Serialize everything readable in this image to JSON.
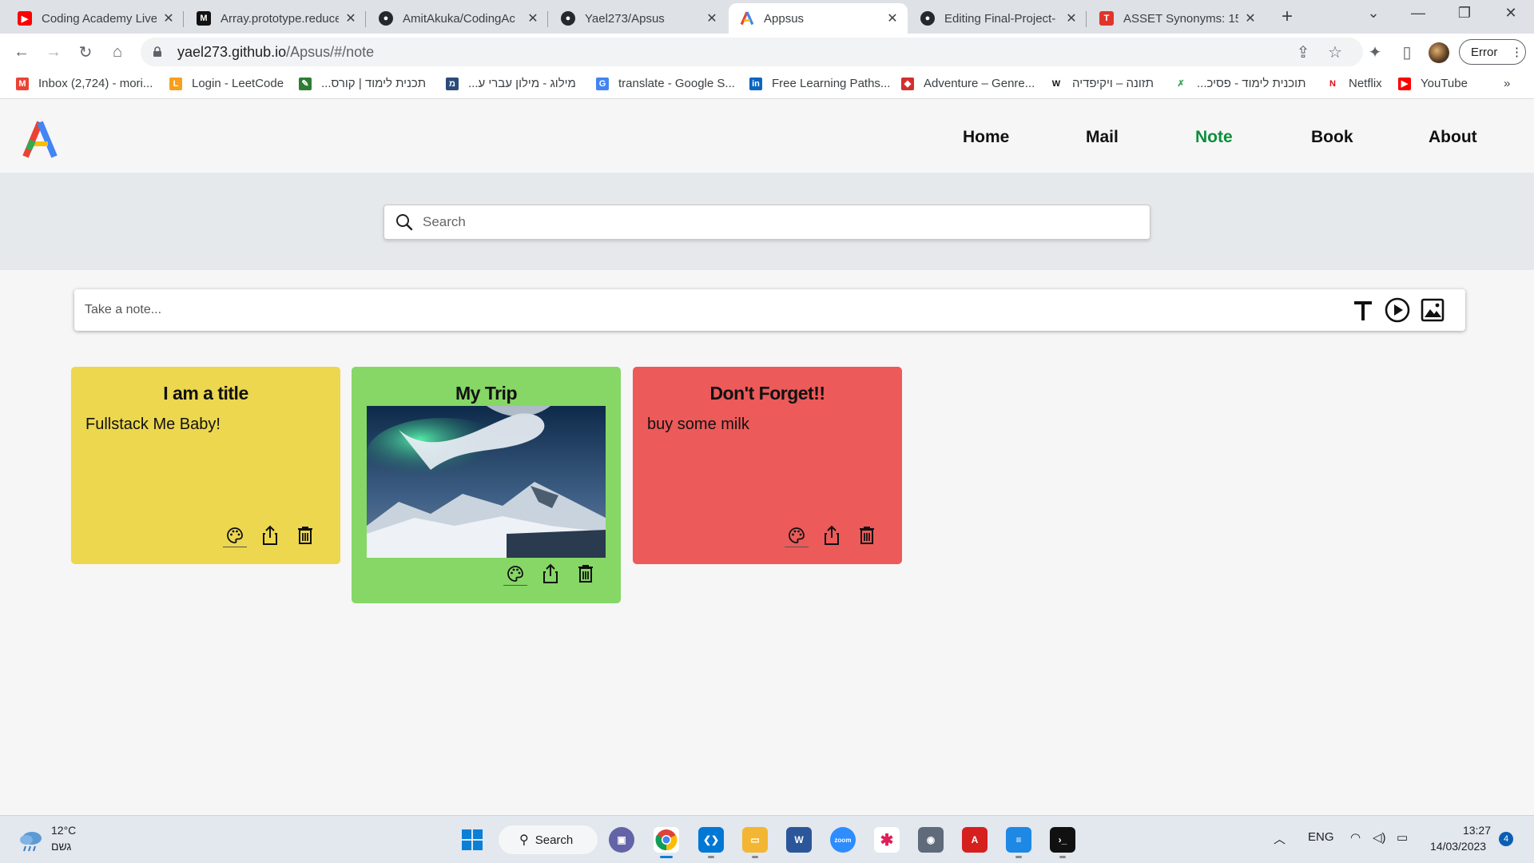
{
  "browser": {
    "tabs": [
      {
        "title": "Coding Academy Live",
        "icon": "youtube-icon",
        "color": "#ff0000"
      },
      {
        "title": "Array.prototype.reduce",
        "icon": "mdn-icon",
        "color": "#111111"
      },
      {
        "title": "AmitAkuka/CodingAc",
        "icon": "github-icon",
        "color": "#24292f"
      },
      {
        "title": "Yael273/Apsus",
        "icon": "github-icon",
        "color": "#24292f"
      },
      {
        "title": "Appsus",
        "icon": "appsus-icon",
        "color": "#4285f4"
      },
      {
        "title": "Editing Final-Project-",
        "icon": "github-icon",
        "color": "#24292f"
      },
      {
        "title": "ASSET Synonyms: 15",
        "icon": "thesaurus-icon",
        "color": "#e0352b"
      }
    ],
    "url_host": "yael273.github.io",
    "url_path": "/Apsus/#/note",
    "error_label": "Error",
    "bookmarks": [
      {
        "label": "Inbox (2,724) - mori...",
        "icon": "gmail-icon",
        "color": "#ea4335"
      },
      {
        "label": "Login - LeetCode",
        "icon": "leetcode-icon",
        "color": "#f89f1b"
      },
      {
        "label": "תכנית לימוד | קורס...",
        "icon": "course-icon",
        "color": "#2e7d32"
      },
      {
        "label": "מילוג - מילון עברי ע...",
        "icon": "milog-icon",
        "color": "#2a4c7a"
      },
      {
        "label": "translate - Google S...",
        "icon": "google-icon",
        "color": "#4285f4"
      },
      {
        "label": "Free Learning Paths...",
        "icon": "linkedin-icon",
        "color": "#0a66c2"
      },
      {
        "label": "Adventure – Genre...",
        "icon": "adventure-icon",
        "color": "#d32f2f"
      },
      {
        "label": "תזונה – ויקיפדיה",
        "icon": "wikipedia-icon",
        "color": "#111111"
      },
      {
        "label": "תוכנית לימוד - פסיכ...",
        "icon": "psych-icon",
        "color": "#3aa757"
      },
      {
        "label": "Netflix",
        "icon": "netflix-icon",
        "color": "#e50914"
      },
      {
        "label": "YouTube",
        "icon": "youtube-icon",
        "color": "#ff0000"
      }
    ]
  },
  "app": {
    "nav": {
      "home": "Home",
      "mail": "Mail",
      "note": "Note",
      "book": "Book",
      "about": "About"
    },
    "active_nav": "Note",
    "search_placeholder": "Search",
    "note_placeholder": "Take a note...",
    "note_tools": [
      "text-icon",
      "video-icon",
      "image-icon"
    ],
    "notes": [
      {
        "title": "I am a title",
        "text": "Fullstack Me Baby!",
        "color": "#ecd74f",
        "type": "text"
      },
      {
        "title": "My Trip",
        "text": "",
        "color": "#86d766",
        "type": "image",
        "image": "aurora-mountain-landscape"
      },
      {
        "title": "Don't Forget!!",
        "text": "buy some milk",
        "color": "#ec5a5a",
        "type": "text"
      }
    ]
  },
  "taskbar": {
    "weather_temp": "12°C",
    "weather_desc": "גשם",
    "search_label": "Search",
    "lang": "ENG",
    "time": "13:27",
    "date": "14/03/2023",
    "notifications": "4"
  }
}
